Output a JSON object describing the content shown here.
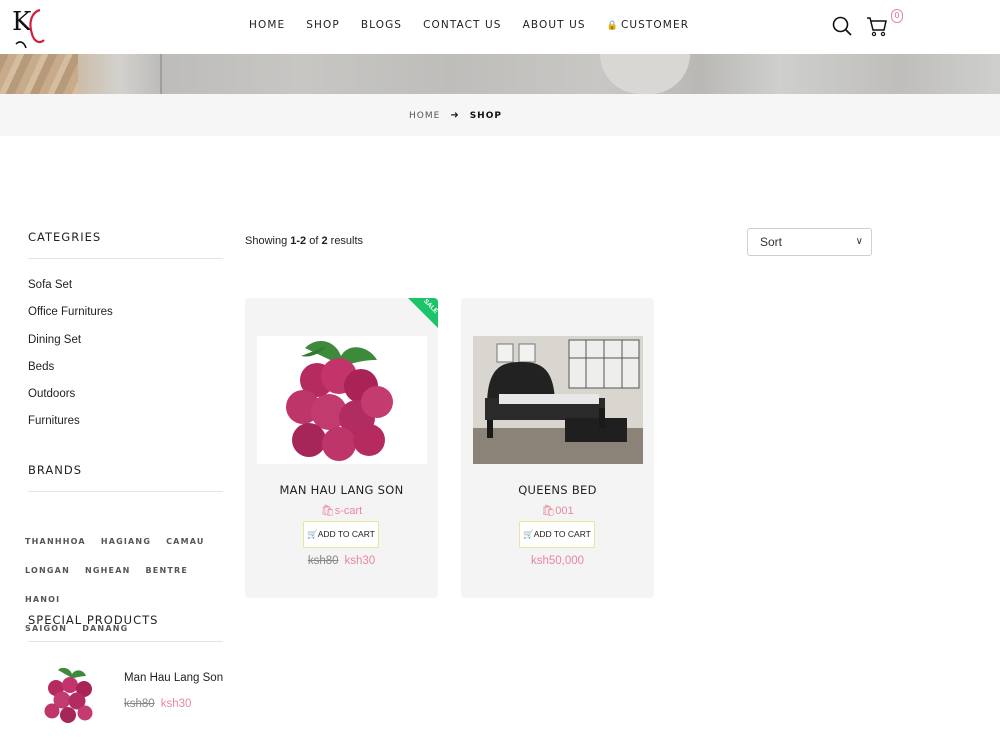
{
  "header": {
    "logo_alt": "KC",
    "nav": [
      "HOME",
      "SHOP",
      "BLOGS",
      "CONTACT US",
      "ABOUT US",
      "CUSTOMER"
    ],
    "cart_count": "0"
  },
  "breadcrumb": {
    "home": "HOME",
    "current": "SHOP"
  },
  "sidebar": {
    "categories_title": "CATEGRIES",
    "categories": [
      "Sofa Set",
      "Office Furnitures",
      "Dining Set",
      "Beds",
      "Outdoors",
      "Furnitures"
    ],
    "brands_title": "BRANDS",
    "brands": [
      "THANHHOA",
      "HAGIANG",
      "CAMAU",
      "LONGAN",
      "NGHEAN",
      "BENTRE",
      "HANOI",
      "SAIGON",
      "DANANG"
    ],
    "special_title": "SPECIAL PRODUCTS",
    "special": {
      "name": "Man Hau Lang Son",
      "old_price": "ksh80",
      "price": "ksh30"
    }
  },
  "main": {
    "showing_prefix": "Showing ",
    "showing_range": "1-2",
    "showing_of": " of ",
    "showing_total": "2",
    "showing_suffix": " results",
    "sort_label": "Sort",
    "products": [
      {
        "title": "MAN HAU LANG SON",
        "sku": "s-cart",
        "button": "ADD TO CART",
        "old_price": "ksh80",
        "price": "ksh30",
        "badge": "SALE"
      },
      {
        "title": "QUEENS BED",
        "sku": "001",
        "button": "ADD TO CART",
        "price": "ksh50,000"
      }
    ]
  },
  "colors": {
    "accent_pink": "#e8889d",
    "sale_green": "#1ac56a",
    "button_border": "#e7e79a"
  }
}
